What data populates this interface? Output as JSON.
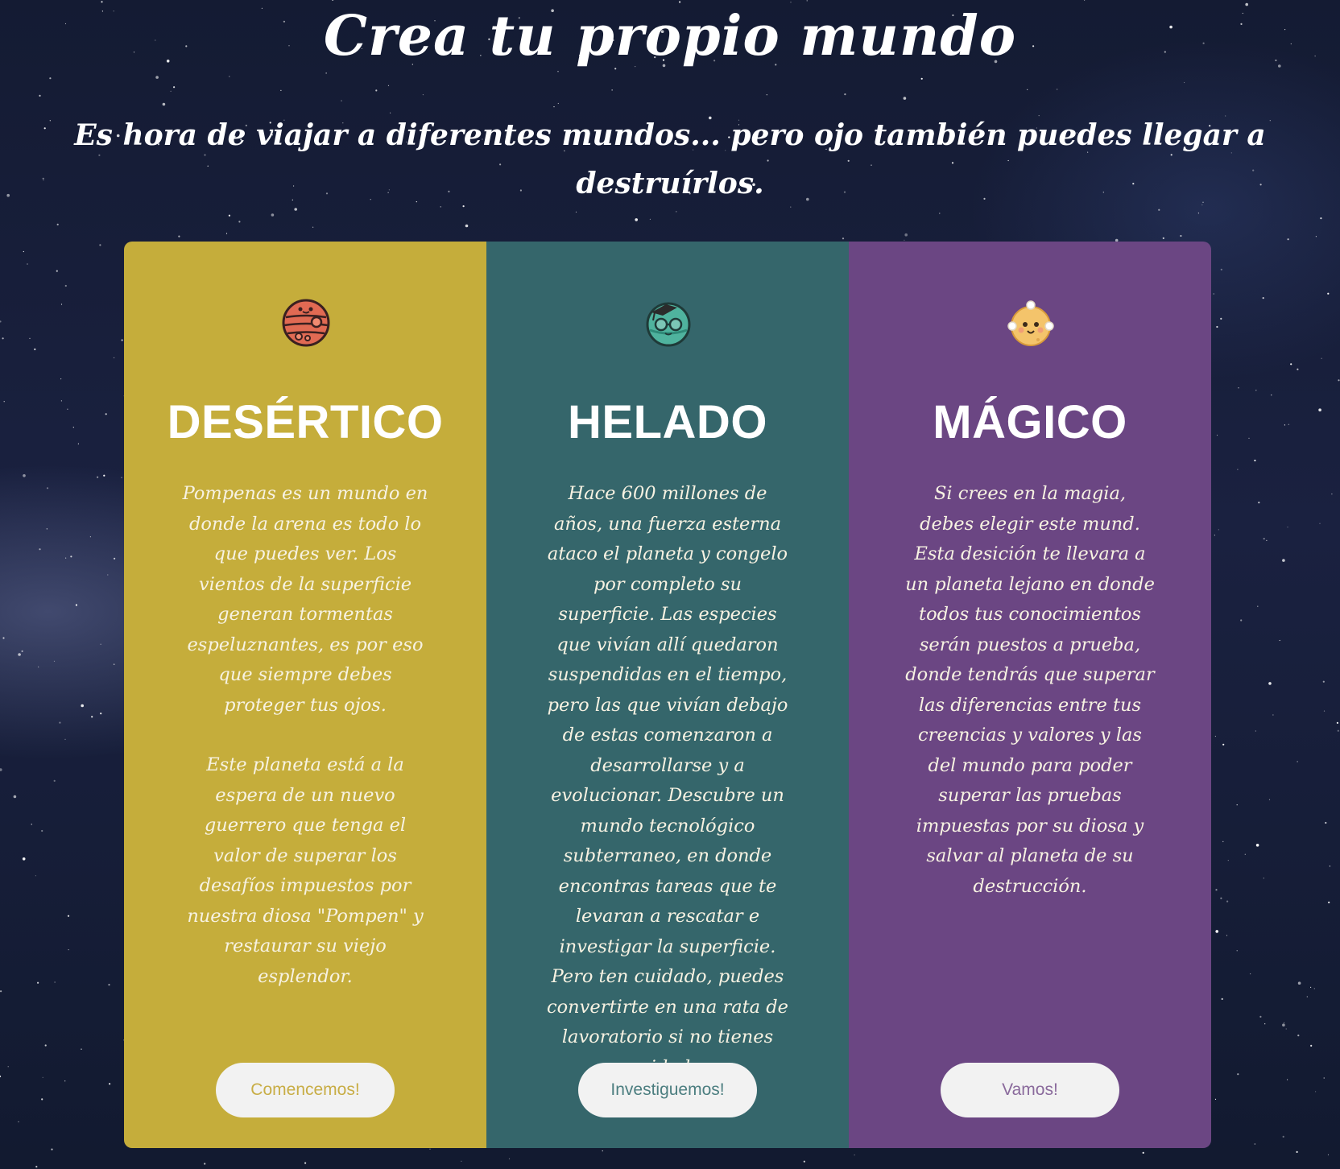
{
  "hero": {
    "title": "Crea tu propio mundo",
    "subtitle": "Es hora de viajar a diferentes mundos... pero ojo también puedes llegar a destruírlos."
  },
  "cards": [
    {
      "title": "DESÉRTICO",
      "icon": "desert-planet-icon",
      "bg_color": "#c5ad3b",
      "button_text_color": "#c8ad45",
      "paragraphs": [
        "Pompenas es un mundo en donde la arena es todo lo que puedes ver. Los vientos de la superficie generan tormentas espeluznantes, es por eso que siempre debes proteger tus ojos.",
        "Este planeta está a la espera de un nuevo guerrero que tenga el valor de superar los desafíos impuestos por nuestra diosa \"Pompen\" y restaurar su viejo esplendor."
      ],
      "button_label": "Comencemos!"
    },
    {
      "title": "HELADO",
      "icon": "ice-planet-icon",
      "bg_color": "#35666b",
      "button_text_color": "#4c7e80",
      "paragraphs": [
        "Hace 600 millones de años, una fuerza esterna ataco el planeta y congelo por completo su superficie. Las especies que vivían allí quedaron suspendidas en el tiempo, pero las que vivían debajo de estas comenzaron a desarrollarse y a evolucionar. Descubre un mundo tecnológico subterraneo, en donde encontras tareas que te levaran a rescatar e investigar la superficie. Pero ten cuidado, puedes convertirte en una rata de lavoratorio si no tienes cuidado."
      ],
      "button_label": "Investiguemos!"
    },
    {
      "title": "MÁGICO",
      "icon": "magic-planet-icon",
      "bg_color": "#6b4683",
      "button_text_color": "#8a6a9c",
      "paragraphs": [
        "Si crees en la magia, debes elegir este mund. Esta desición te llevara a un planeta lejano en donde todos tus conocimientos serán puestos a prueba, donde tendrás que superar las diferencias entre tus creencias y valores y las del mundo para poder superar las pruebas impuestas por su diosa y salvar al planeta de su destrucción."
      ],
      "button_label": "Vamos!"
    }
  ]
}
